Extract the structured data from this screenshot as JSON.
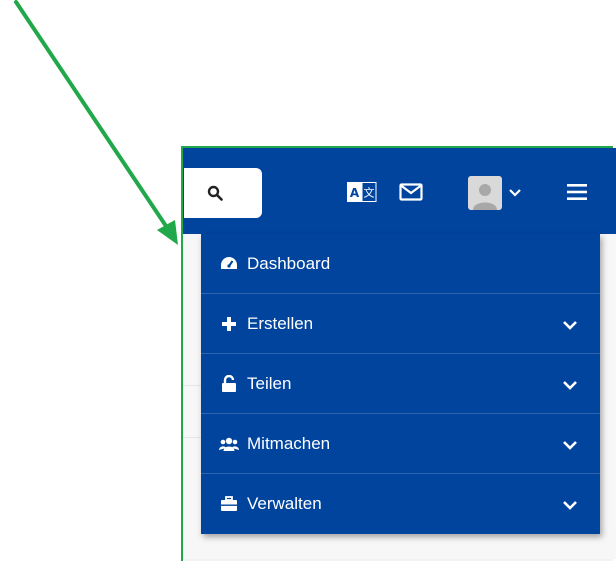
{
  "navbar": {
    "search_icon": "search-icon",
    "translate_icon": "translate-icon",
    "mail_icon": "mail-icon",
    "avatar_icon": "user-avatar-icon",
    "avatar_dropdown_icon": "chevron-down-icon",
    "menu_icon": "hamburger-icon",
    "background_color": "#00449e"
  },
  "menu": {
    "items": [
      {
        "label": "Dashboard",
        "icon": "dashboard-icon",
        "has_submenu": false
      },
      {
        "label": "Erstellen",
        "icon": "plus-icon",
        "has_submenu": true
      },
      {
        "label": "Teilen",
        "icon": "unlock-icon",
        "has_submenu": true
      },
      {
        "label": "Mitmachen",
        "icon": "users-icon",
        "has_submenu": true
      },
      {
        "label": "Verwalten",
        "icon": "briefcase-icon",
        "has_submenu": true
      }
    ]
  },
  "annotation": {
    "arrow_color": "#21a84a",
    "border_color": "#21a84a"
  }
}
